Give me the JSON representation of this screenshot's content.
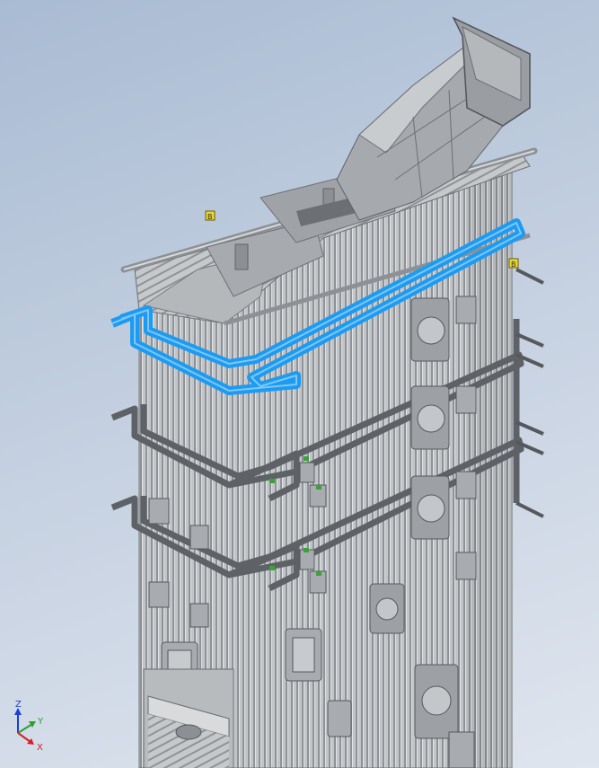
{
  "viewport": {
    "background_top": "#a9bbd3",
    "background_bottom": "#dfe5ee"
  },
  "model": {
    "body_color": "#b9bcbf",
    "tube_color": "#8e9296",
    "frame_color": "#5e6266",
    "highlight_color": "#1e9bf0",
    "marker_color": "#3ca03c",
    "flag_color": "#e7d63a"
  },
  "annotations": {
    "flag_1": "B",
    "flag_2": "B"
  },
  "triad": {
    "z_label": "Z",
    "y_label": "Y",
    "x_label": "X",
    "z_color": "#1a3fd6",
    "y_color": "#2aa02a",
    "x_color": "#d62020"
  }
}
